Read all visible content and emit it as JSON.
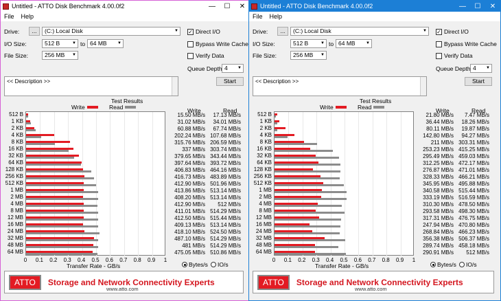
{
  "windows": [
    {
      "id": "left",
      "title": "Untitled - ATTO Disk Benchmark 4.00.0f2",
      "menu": [
        "File",
        "Help"
      ],
      "drive_label": "Drive:",
      "browse_label": "...",
      "drive_value": "(C:) Local Disk",
      "io_size_label": "I/O Size:",
      "io_from": "512 B",
      "to_label": "to",
      "io_to": "64 MB",
      "file_size_label": "File Size:",
      "file_size": "256 MB",
      "direct_io": {
        "label": "Direct I/O",
        "checked": true
      },
      "bypass_cache": {
        "label": "Bypass Write Cache",
        "checked": false
      },
      "verify": {
        "label": "Verify Data",
        "checked": false
      },
      "queue_label": "Queue Depth:",
      "queue_value": "4",
      "description": "<< Description >>",
      "start_label": "Start",
      "results_title": "Test Results",
      "legend_write": "Write",
      "legend_read": "Read",
      "col_write": "Write",
      "col_read": "Read",
      "x_label": "Transfer Rate - GB/s",
      "x_ticks": [
        "0",
        "0.1",
        "0.2",
        "0.3",
        "0.4",
        "0.5",
        "0.6",
        "0.7",
        "0.8",
        "0.9",
        "1"
      ],
      "radio_bytes": "Bytes/s",
      "radio_io": "IO/s",
      "banner_logo": "ATTO",
      "banner_tag": "Storage and Network Connectivity Experts",
      "banner_url": "www.atto.com"
    },
    {
      "id": "right",
      "title": "Untitled - ATTO Disk Benchmark 4.00.0f2",
      "menu": [
        "File",
        "Help"
      ],
      "drive_label": "Drive:",
      "browse_label": "...",
      "drive_value": "(C:) Local Disk",
      "io_size_label": "I/O Size:",
      "io_from": "512 B",
      "to_label": "to",
      "io_to": "64 MB",
      "file_size_label": "File Size:",
      "file_size": "256 MB",
      "direct_io": {
        "label": "Direct I/O",
        "checked": true
      },
      "bypass_cache": {
        "label": "Bypass Write Cache",
        "checked": false
      },
      "verify": {
        "label": "Verify Data",
        "checked": false
      },
      "queue_label": "Queue Depth:",
      "queue_value": "4",
      "description": "<< Description >>",
      "start_label": "Start",
      "results_title": "Test Results",
      "legend_write": "Write",
      "legend_read": "Read",
      "col_write": "Write",
      "col_read": "Read",
      "x_label": "Transfer Rate - GB/s",
      "x_ticks": [
        "0",
        "0.1",
        "0.2",
        "0.3",
        "0.4",
        "0.5",
        "0.6",
        "0.7",
        "0.8",
        "0.9",
        "1"
      ],
      "radio_bytes": "Bytes/s",
      "radio_io": "IO/s",
      "banner_logo": "ATTO",
      "banner_tag": "Storage and Network Connectivity Experts",
      "banner_url": "www.atto.com"
    }
  ],
  "chart_data": [
    {
      "type": "bar",
      "categories": [
        "512 B",
        "1 KB",
        "2 KB",
        "4 KB",
        "8 KB",
        "16 KB",
        "32 KB",
        "64 KB",
        "128 KB",
        "256 KB",
        "512 KB",
        "1 MB",
        "2 MB",
        "4 MB",
        "8 MB",
        "12 MB",
        "16 MB",
        "24 MB",
        "32 MB",
        "48 MB",
        "64 MB"
      ],
      "write_text": [
        "15.50 MB/s",
        "31.02 MB/s",
        "60.88 MB/s",
        "202.24 MB/s",
        "315.76 MB/s",
        "337 MB/s",
        "379.65 MB/s",
        "397.64 MB/s",
        "406.83 MB/s",
        "416.73 MB/s",
        "412.90 MB/s",
        "413.86 MB/s",
        "408.20 MB/s",
        "412.90 MB/s",
        "411.01 MB/s",
        "412.50 MB/s",
        "409.13 MB/s",
        "418.10 MB/s",
        "487.10 MB/s",
        "481 MB/s",
        "475.05 MB/s"
      ],
      "read_text": [
        "17.13 MB/s",
        "34.01 MB/s",
        "67.74 MB/s",
        "107.68 MB/s",
        "206.59 MB/s",
        "303.74 MB/s",
        "343.44 MB/s",
        "393.72 MB/s",
        "464.16 MB/s",
        "483.89 MB/s",
        "501.96 MB/s",
        "513.14 MB/s",
        "513.14 MB/s",
        "512 MB/s",
        "514.29 MB/s",
        "515.44 MB/s",
        "513.14 MB/s",
        "524.50 MB/s",
        "514.29 MB/s",
        "514.29 MB/s",
        "510.86 MB/s"
      ],
      "series": [
        {
          "name": "Write",
          "values": [
            0.0155,
            0.031,
            0.0609,
            0.2022,
            0.3158,
            0.337,
            0.3797,
            0.3976,
            0.4068,
            0.4167,
            0.4129,
            0.4139,
            0.4082,
            0.4129,
            0.411,
            0.4125,
            0.4091,
            0.4181,
            0.4871,
            0.481,
            0.4751
          ]
        },
        {
          "name": "Read",
          "values": [
            0.0171,
            0.034,
            0.0677,
            0.1077,
            0.2066,
            0.3037,
            0.3434,
            0.3937,
            0.4642,
            0.4839,
            0.502,
            0.5131,
            0.5131,
            0.512,
            0.5143,
            0.5154,
            0.5131,
            0.5245,
            0.5143,
            0.5143,
            0.5109
          ]
        }
      ],
      "xlabel": "Transfer Rate - GB/s",
      "xlim": [
        0,
        1
      ]
    },
    {
      "type": "bar",
      "categories": [
        "512 B",
        "1 KB",
        "2 KB",
        "4 KB",
        "8 KB",
        "16 KB",
        "32 KB",
        "64 KB",
        "128 KB",
        "256 KB",
        "512 KB",
        "1 MB",
        "2 MB",
        "4 MB",
        "8 MB",
        "12 MB",
        "16 MB",
        "24 MB",
        "32 MB",
        "48 MB",
        "64 MB"
      ],
      "write_text": [
        "21.80 MB/s",
        "36.44 MB/s",
        "80.11 MB/s",
        "142.80 MB/s",
        "211 MB/s",
        "253.23 MB/s",
        "295.49 MB/s",
        "312.25 MB/s",
        "276.87 MB/s",
        "328.33 MB/s",
        "345.95 MB/s",
        "340.58 MB/s",
        "333.19 MB/s",
        "310.30 MB/s",
        "293.58 MB/s",
        "317.31 MB/s",
        "247.94 MB/s",
        "268.84 MB/s",
        "356.38 MB/s",
        "289.74 MB/s",
        "290.91 MB/s"
      ],
      "read_text": [
        "7.47 MB/s",
        "18.26 MB/s",
        "19.87 MB/s",
        "94.27 MB/s",
        "303.31 MB/s",
        "415.25 MB/s",
        "459.03 MB/s",
        "472.17 MB/s",
        "471.01 MB/s",
        "466.21 MB/s",
        "495.88 MB/s",
        "515.44 MB/s",
        "516.59 MB/s",
        "478.50 MB/s",
        "498.30 MB/s",
        "476.75 MB/s",
        "470.80 MB/s",
        "466.23 MB/s",
        "506.37 MB/s",
        "458.18 MB/s",
        "512 MB/s"
      ],
      "series": [
        {
          "name": "Write",
          "values": [
            0.0218,
            0.0364,
            0.0801,
            0.1428,
            0.211,
            0.2532,
            0.2955,
            0.3123,
            0.2769,
            0.3283,
            0.346,
            0.3406,
            0.3332,
            0.3103,
            0.2936,
            0.3173,
            0.2479,
            0.2688,
            0.3564,
            0.2897,
            0.2909
          ]
        },
        {
          "name": "Read",
          "values": [
            0.0075,
            0.0183,
            0.0199,
            0.0943,
            0.3033,
            0.4153,
            0.459,
            0.4722,
            0.471,
            0.4662,
            0.4959,
            0.5154,
            0.5166,
            0.4785,
            0.4983,
            0.4768,
            0.4708,
            0.4662,
            0.5064,
            0.4582,
            0.512
          ]
        }
      ],
      "xlabel": "Transfer Rate - GB/s",
      "xlim": [
        0,
        1
      ]
    }
  ]
}
